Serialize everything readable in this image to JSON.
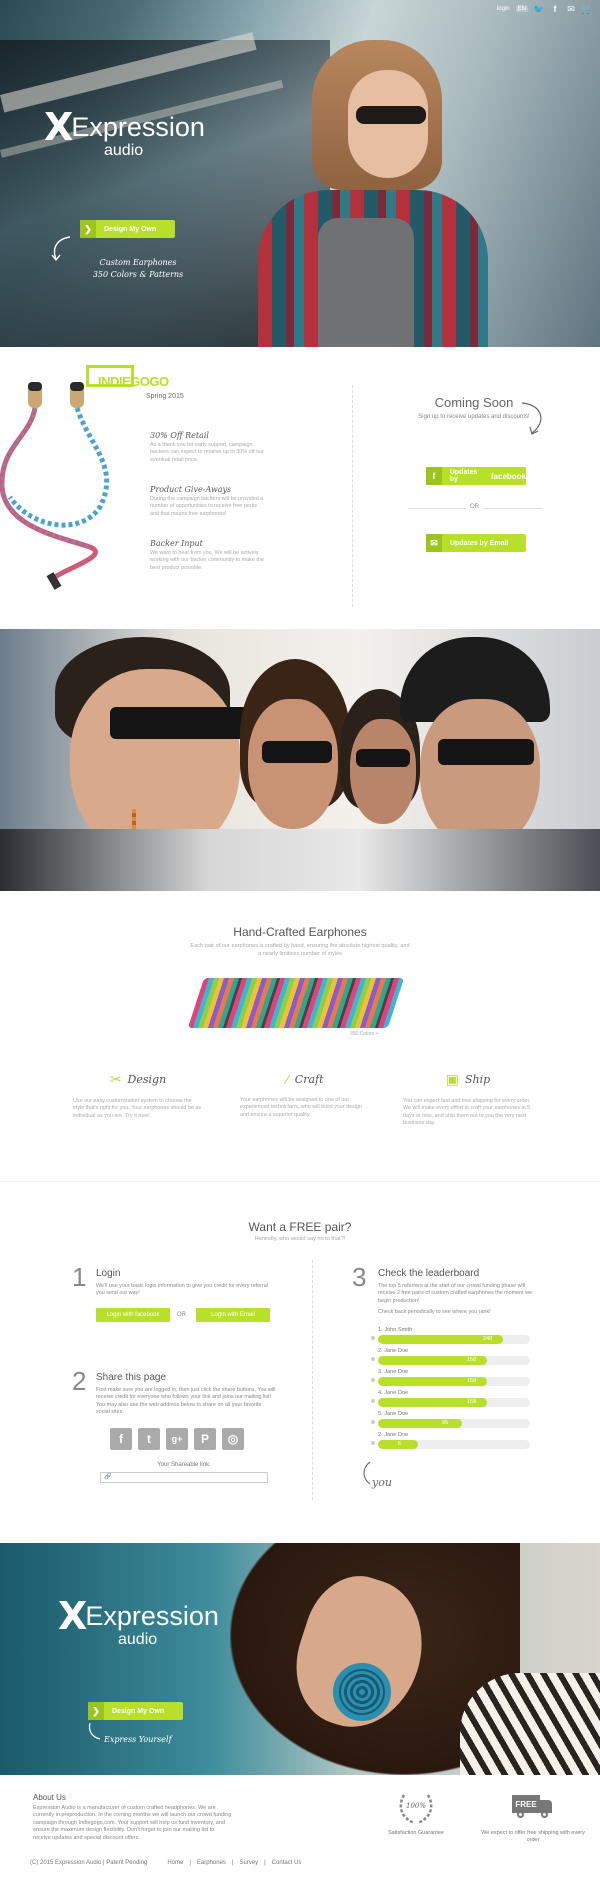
{
  "topbar": {
    "login": "login",
    "lang": "EN",
    "icons": [
      "twitter-icon",
      "facebook-icon",
      "mail-icon",
      "cart-icon"
    ]
  },
  "hero": {
    "logo_word": "Expression",
    "logo_sub": "audio",
    "cta": "Design My Own",
    "tagline_1": "Custom Earphones",
    "tagline_2": "350 Colors & Patterns"
  },
  "campaign": {
    "brand": "INDIEGOGO",
    "season": "Spring 2015",
    "perks": [
      {
        "title": "30% Off Retail",
        "text": "As a thank you for early support, campaign backers can expect to receive up to 30% off our eventual retail price."
      },
      {
        "title": "Product Give-Aways",
        "text": "During the campaign backers will be provided a number of opportunities to receive free perks and that means free earphones!"
      },
      {
        "title": "Backer Input",
        "text": "We want to hear from you. We will be actively working with our backer community to make the best product possible."
      }
    ],
    "coming_title": "Coming Soon",
    "coming_sub": "Sign up to receive updates and discounts!",
    "fb_label": "Updates by",
    "fb_brand": "facebook",
    "or": "OR",
    "email_label": "Updates by Email"
  },
  "craft": {
    "title": "Hand-Crafted Earphones",
    "subtitle": "Each pair of our earphones is crafted by hand, ensuring the absolute highest quality, and a nearly limitless number of styles",
    "caption": "350 Colors +",
    "features": [
      {
        "title": "Design",
        "icon": "utensils-icon",
        "text": "Use our easy customization system to choose the style that's right for you. Your earphones should be as individual as you are. Try it now!"
      },
      {
        "title": "Craft",
        "icon": "needle-icon",
        "text": "Your earphones will be assigned to one of our experienced technicians, who will build your design and ensure a superior quality."
      },
      {
        "title": "Ship",
        "icon": "box-icon",
        "text": "You can expect fast and free shipping for every order. We will make every effort to craft your earphones in 5 days or less, and ship them out to you the very next business day."
      }
    ]
  },
  "free": {
    "title": "Want a FREE pair?",
    "subtitle": "Honestly, who would say no to that?!",
    "step1": {
      "num": "1",
      "title": "Login",
      "text": "We'll use your basic login information to give you credit for every referral you send our way!",
      "fb": "Login with facebook",
      "or": "OR",
      "email": "Login with Email"
    },
    "step2": {
      "num": "2",
      "title": "Share this page",
      "text": "First make sure you are logged in, then just click the share buttons. You will receive credit for everyone who follows your link and joins our mailing list! You may also use the web address below to share on all your favorite social sites.",
      "link_label": "Your Shareable link:",
      "link_value": ""
    },
    "step3": {
      "num": "3",
      "title": "Check the leaderboard",
      "text": "The top 5 referrers at the start of our crowd funding phase will receive 2 free pairs of custom crafted earphones the moment we begin production!",
      "text2": "Check back periodically to see where you rank!",
      "you": "you"
    },
    "leaderboard": [
      {
        "name": "1. John Smith",
        "value": 240,
        "pct": 0.82
      },
      {
        "name": "2. Jane Doe",
        "value": 158,
        "pct": 0.72
      },
      {
        "name": "3. Jane Doe",
        "value": 158,
        "pct": 0.72
      },
      {
        "name": "4. Jane Doe",
        "value": 158,
        "pct": 0.72
      },
      {
        "name": "5. Jane Doe",
        "value": 95,
        "pct": 0.55
      },
      {
        "name": "2. Jane Doe",
        "value": 6,
        "pct": 0.26
      }
    ]
  },
  "hero2": {
    "logo_word": "Expression",
    "logo_sub": "audio",
    "cta": "Design My Own",
    "tagline": "Express Yourself"
  },
  "footer": {
    "about_title": "About Us",
    "about_text": "Expression Audio is a manufacturer of custom crafted headphones. We are currently in preproduction. In the coming months we will launch our crowd funding campaign through Indiegogo.com. Your support will help us fund inventory, and ensure the maximum design flexibility. Don't forget to join our mailing list to receive updates and special discount offers.",
    "badge_text": "100%",
    "badge_label": "Satisfaction Guarantee",
    "free_badge": "FREE",
    "ship_label": "We expect to offer free shipping with every order",
    "copyright": "(C) 2015 Expression Audio | Patent Pending",
    "links": [
      "Home",
      "Earphones",
      "Survey",
      "Contact Us"
    ]
  }
}
